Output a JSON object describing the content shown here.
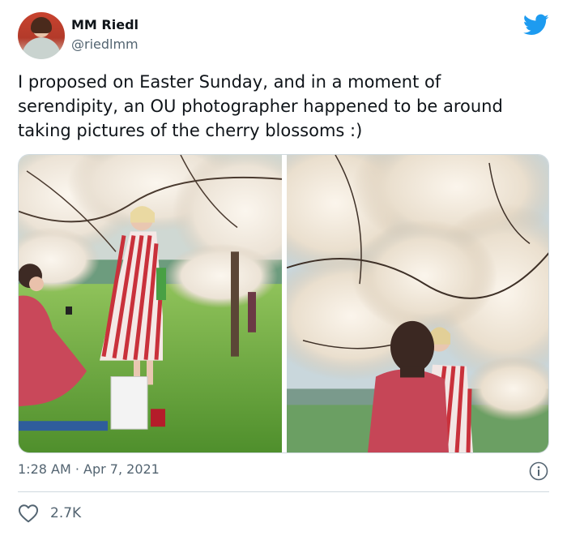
{
  "tweet": {
    "author_name": "MM Riedl",
    "author_handle": "@riedlmm",
    "text": "I proposed on Easter Sunday, and in a moment of serendipity, an OU photographer happened to be around taking pictures of the cherry blossoms :)",
    "timestamp": "1:28 AM · Apr 7, 2021",
    "like_count": "2.7K"
  },
  "icons": {
    "brand": "twitter-bird-icon",
    "info": "info-icon",
    "like": "heart-icon"
  },
  "colors": {
    "brand_blue": "#1d9bf0",
    "secondary_text": "#536471",
    "primary_text": "#0f1419",
    "divider": "#cfd9de"
  }
}
